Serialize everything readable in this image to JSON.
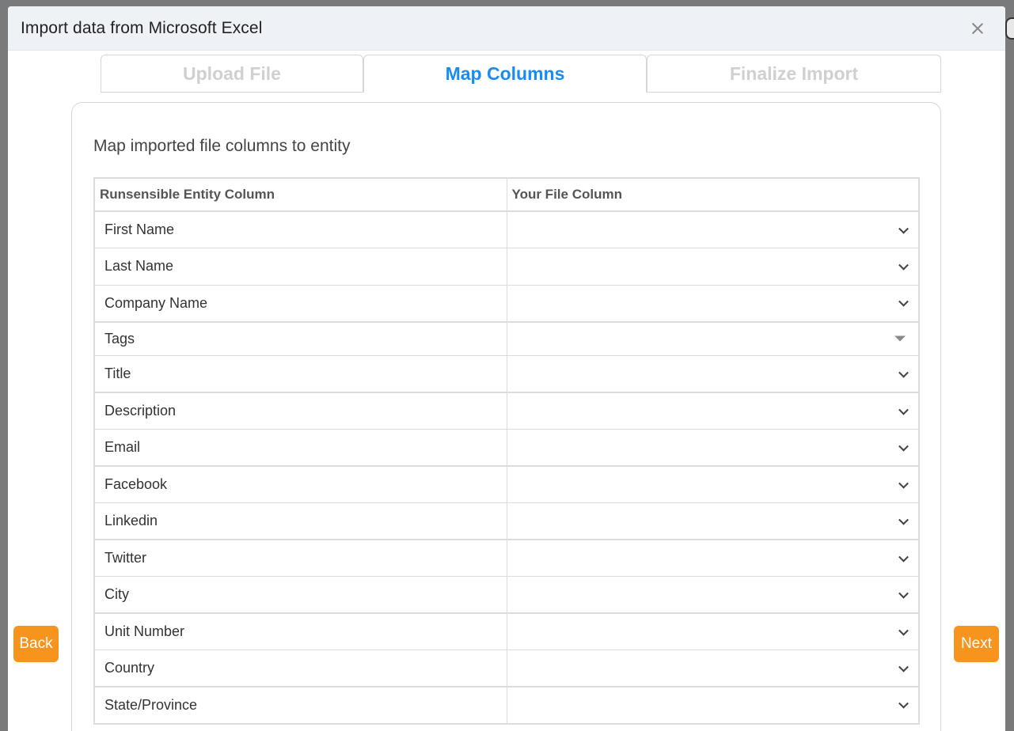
{
  "modal": {
    "title": "Import data from Microsoft Excel"
  },
  "tabs": [
    {
      "label": "Upload File",
      "state": "disabled"
    },
    {
      "label": "Map Columns",
      "state": "active"
    },
    {
      "label": "Finalize Import",
      "state": "disabled"
    }
  ],
  "section": {
    "title": "Map imported file columns to entity"
  },
  "table": {
    "headers": [
      "Runsensible Entity Column",
      "Your File Column"
    ],
    "rows": [
      {
        "entity": "First Name",
        "file_column": ""
      },
      {
        "entity": "Last Name",
        "file_column": ""
      },
      {
        "entity": "Company Name",
        "file_column": ""
      },
      {
        "entity": "Tags",
        "file_column": ""
      },
      {
        "entity": "Title",
        "file_column": ""
      },
      {
        "entity": "Description",
        "file_column": ""
      },
      {
        "entity": "Email",
        "file_column": ""
      },
      {
        "entity": "Facebook",
        "file_column": ""
      },
      {
        "entity": "Linkedin",
        "file_column": ""
      },
      {
        "entity": "Twitter",
        "file_column": ""
      },
      {
        "entity": "City",
        "file_column": ""
      },
      {
        "entity": "Unit Number",
        "file_column": ""
      },
      {
        "entity": "Country",
        "file_column": ""
      },
      {
        "entity": "State/Province",
        "file_column": ""
      }
    ]
  },
  "buttons": {
    "back_label": "Back",
    "next_label": "Next"
  },
  "colors": {
    "accent_blue": "#1a8cf0",
    "button_orange": "#f7941d",
    "header_bg": "#eef1f5"
  }
}
